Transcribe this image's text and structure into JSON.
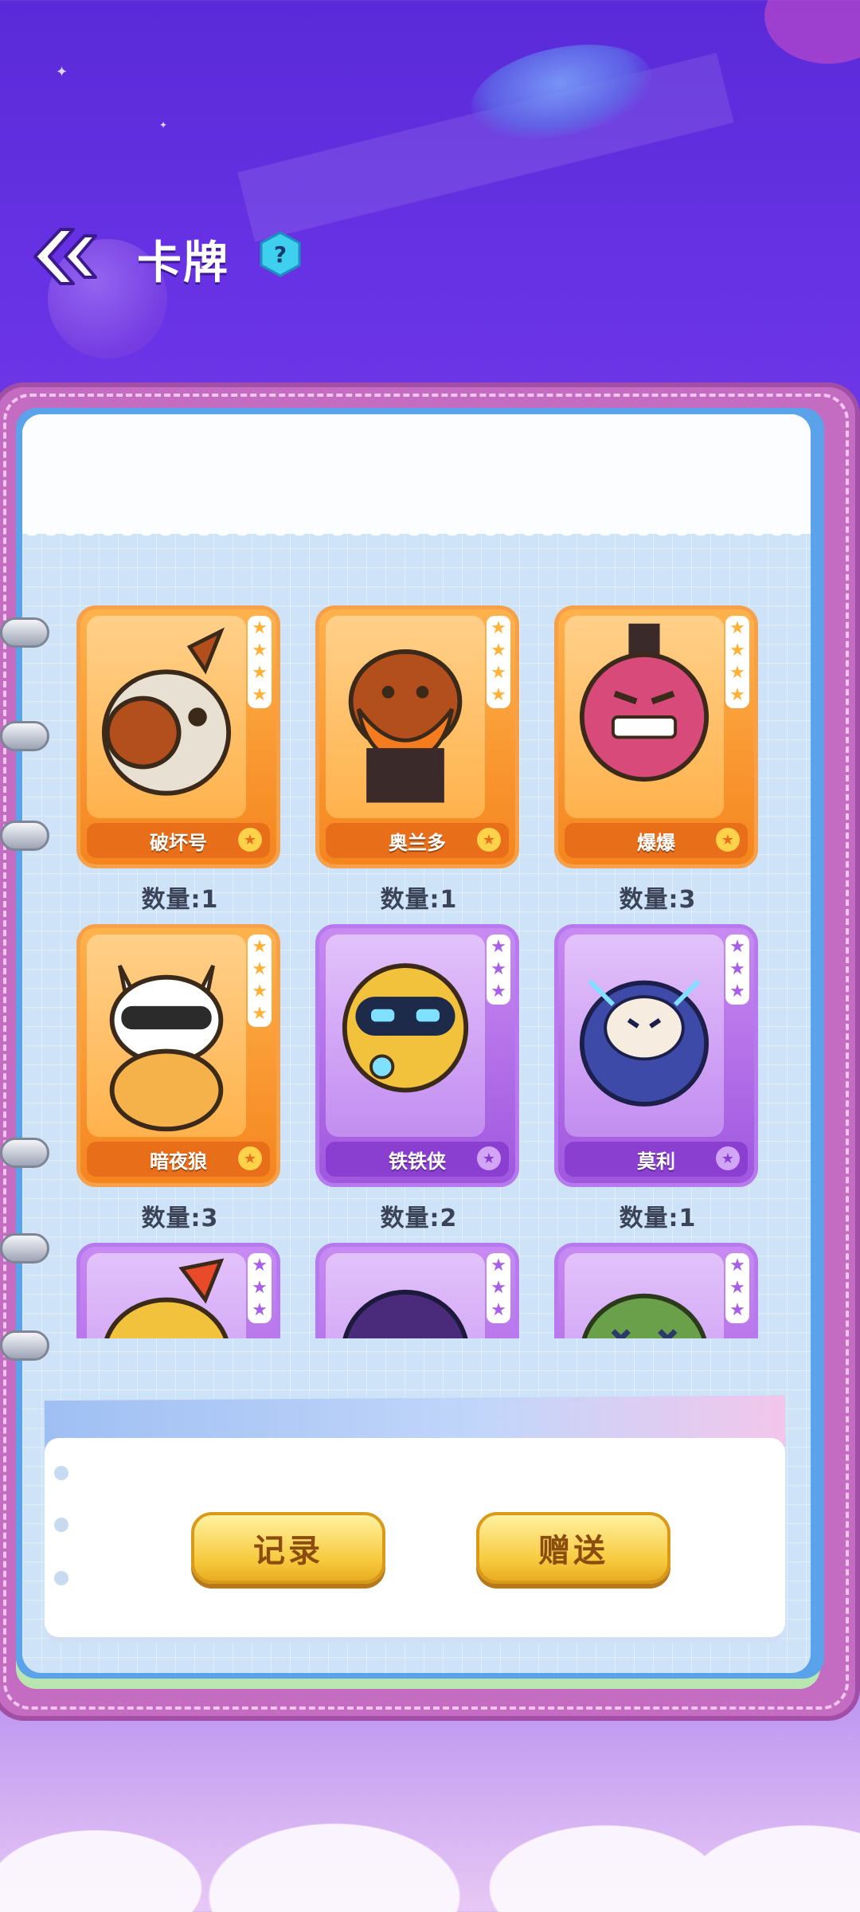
{
  "header": {
    "title": "卡牌",
    "help_label": "?"
  },
  "cards": [
    {
      "name": "破坏号",
      "quantity": "数量:1",
      "rarity": "orange",
      "stars": 4
    },
    {
      "name": "奥兰多",
      "quantity": "数量:1",
      "rarity": "orange",
      "stars": 4
    },
    {
      "name": "爆爆",
      "quantity": "数量:3",
      "rarity": "orange",
      "stars": 4
    },
    {
      "name": "暗夜狼",
      "quantity": "数量:3",
      "rarity": "orange",
      "stars": 4
    },
    {
      "name": "铁铁侠",
      "quantity": "数量:2",
      "rarity": "purple",
      "stars": 3
    },
    {
      "name": "莫利",
      "quantity": "数量:1",
      "rarity": "purple",
      "stars": 3
    },
    {
      "name": "",
      "quantity": "",
      "rarity": "purple",
      "stars": 3
    },
    {
      "name": "",
      "quantity": "",
      "rarity": "purple",
      "stars": 3
    },
    {
      "name": "",
      "quantity": "",
      "rarity": "purple",
      "stars": 3
    }
  ],
  "footer": {
    "record_label": "记录",
    "gift_label": "赠送"
  },
  "colors": {
    "orange_card": "#f5851e",
    "purple_card": "#9f57de",
    "button_yellow": "#f7c93c",
    "background_purple": "#6a34e6"
  }
}
